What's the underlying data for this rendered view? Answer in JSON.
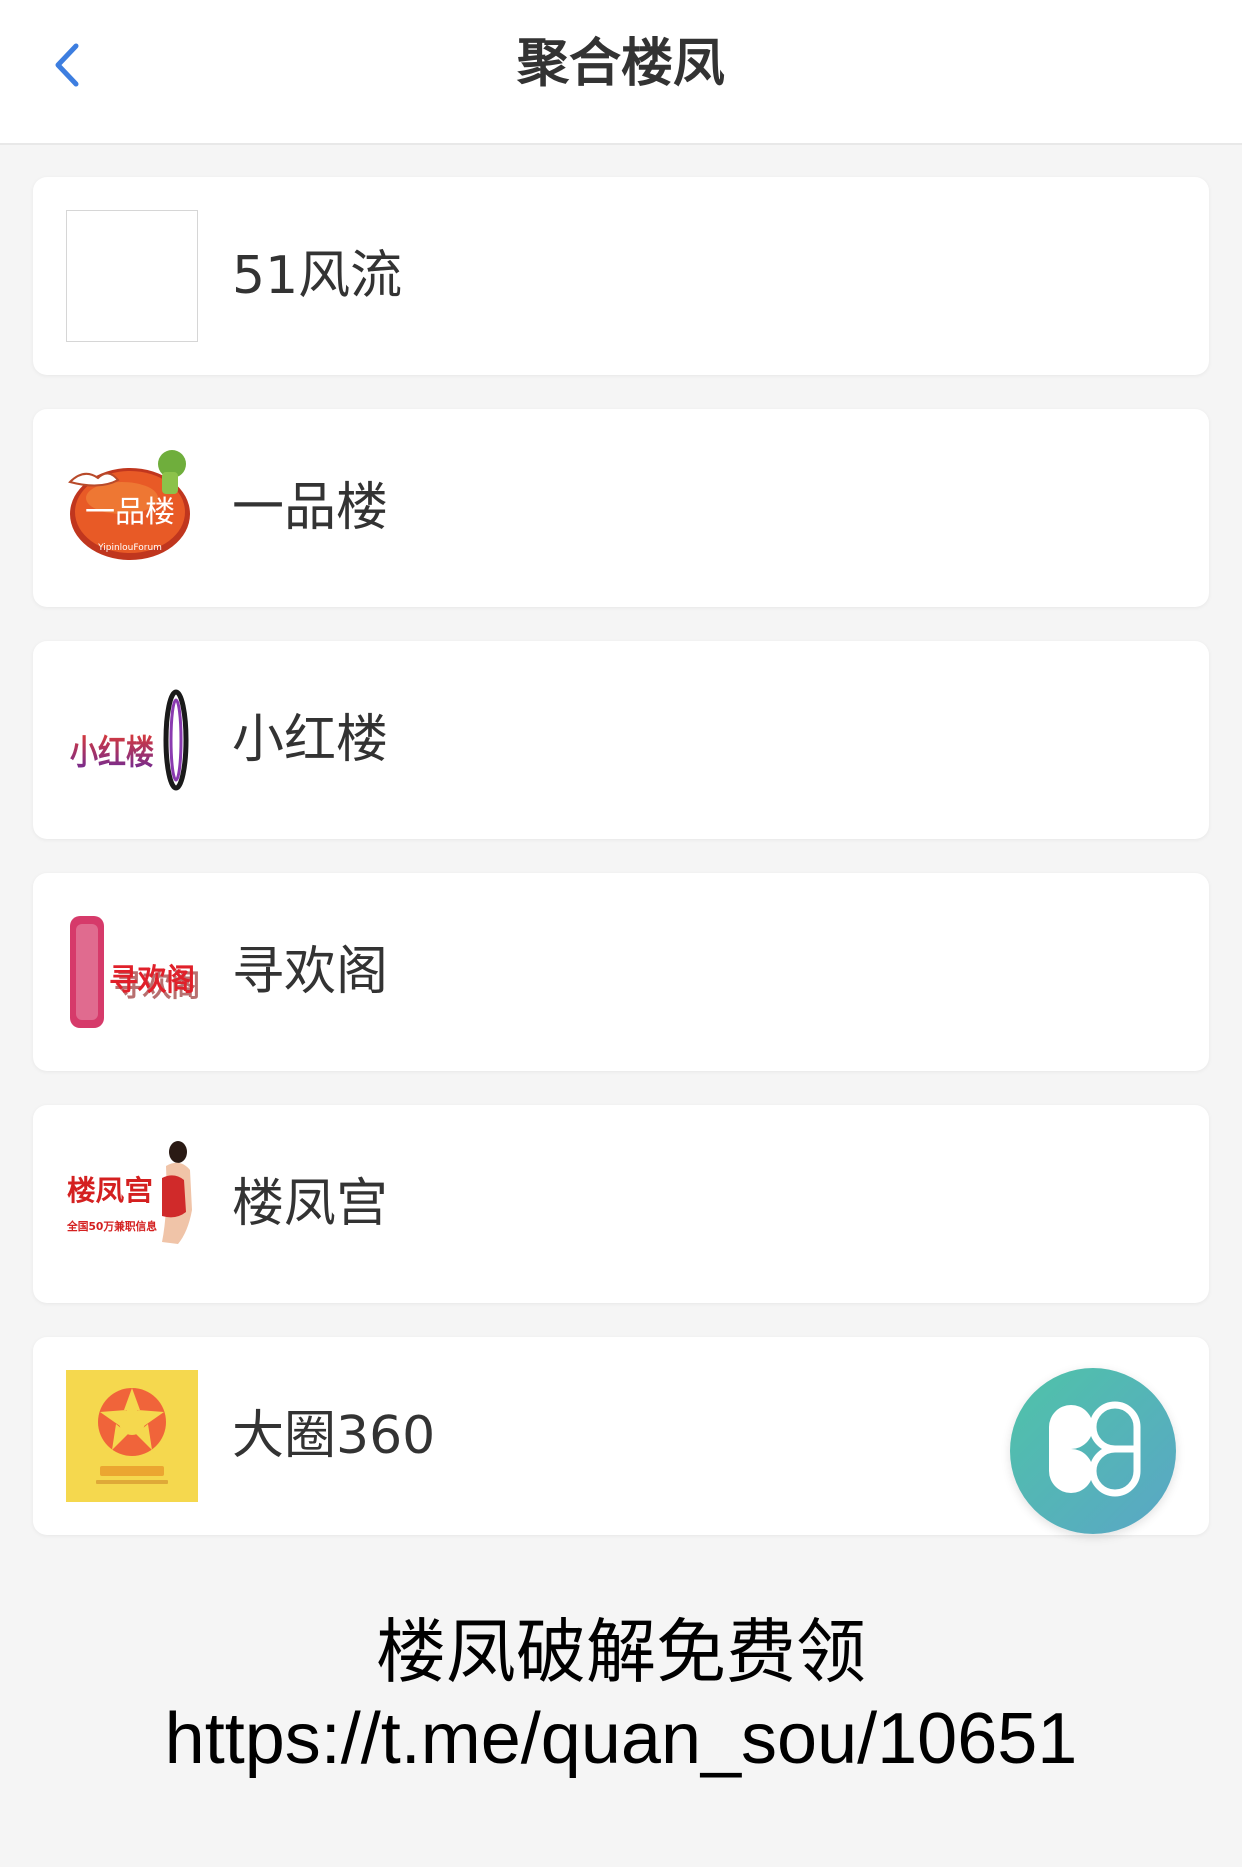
{
  "header": {
    "title": "聚合楼凤",
    "back_icon": "chevron-left-icon",
    "accent_color": "#3d7ee0"
  },
  "items": [
    {
      "label": "51风流",
      "thumb": "blank"
    },
    {
      "label": "一品楼",
      "thumb": "yipinlou-logo",
      "logo_text": "一品楼",
      "logo_sub": "YipinlouForum"
    },
    {
      "label": "小红楼",
      "thumb": "xiaohonglou-logo",
      "logo_text": "小红楼"
    },
    {
      "label": "寻欢阁",
      "thumb": "xunhuange-logo",
      "logo_text": "寻欢阁"
    },
    {
      "label": "楼凤宫",
      "thumb": "loufenggong-logo",
      "logo_text": "楼凤宫",
      "logo_sub": "全国50万兼职信息"
    },
    {
      "label": "大圈360",
      "thumb": "daquan360-logo"
    }
  ],
  "fab": {
    "icon": "clover-icon"
  },
  "promo": {
    "line1": "楼凤破解免费领",
    "line2": "https://t.me/quan_sou/10651"
  }
}
